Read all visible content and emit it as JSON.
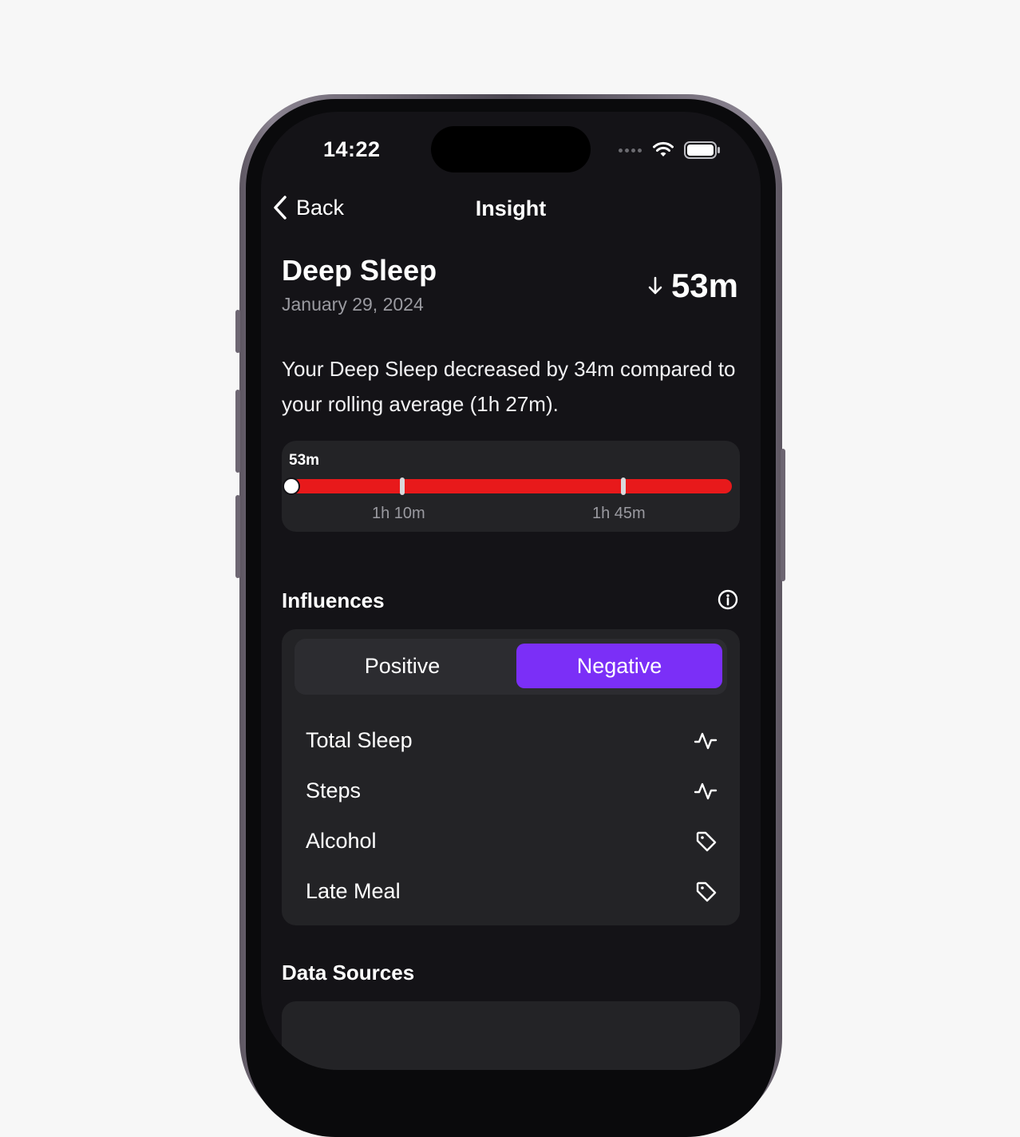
{
  "status_bar": {
    "time": "14:22"
  },
  "nav": {
    "back_label": "Back",
    "title": "Insight"
  },
  "metric": {
    "title": "Deep Sleep",
    "date": "January 29, 2024",
    "value": "53m",
    "trend_icon": "arrow-down-icon"
  },
  "summary": "Your Deep Sleep decreased by 34m compared to your rolling average (1h 27m).",
  "range": {
    "current_label": "53m",
    "tick_labels": [
      "1h 10m",
      "1h 45m"
    ],
    "bar_color": "#e8191b"
  },
  "influences": {
    "title": "Influences",
    "tabs": {
      "positive": "Positive",
      "negative": "Negative",
      "selected": "Negative"
    },
    "accent_color": "#7b2ff7",
    "items": [
      {
        "label": "Total Sleep",
        "icon": "activity-icon"
      },
      {
        "label": "Steps",
        "icon": "activity-icon"
      },
      {
        "label": "Alcohol",
        "icon": "tag-icon"
      },
      {
        "label": "Late Meal",
        "icon": "tag-icon"
      }
    ]
  },
  "data_sources": {
    "title": "Data Sources"
  }
}
